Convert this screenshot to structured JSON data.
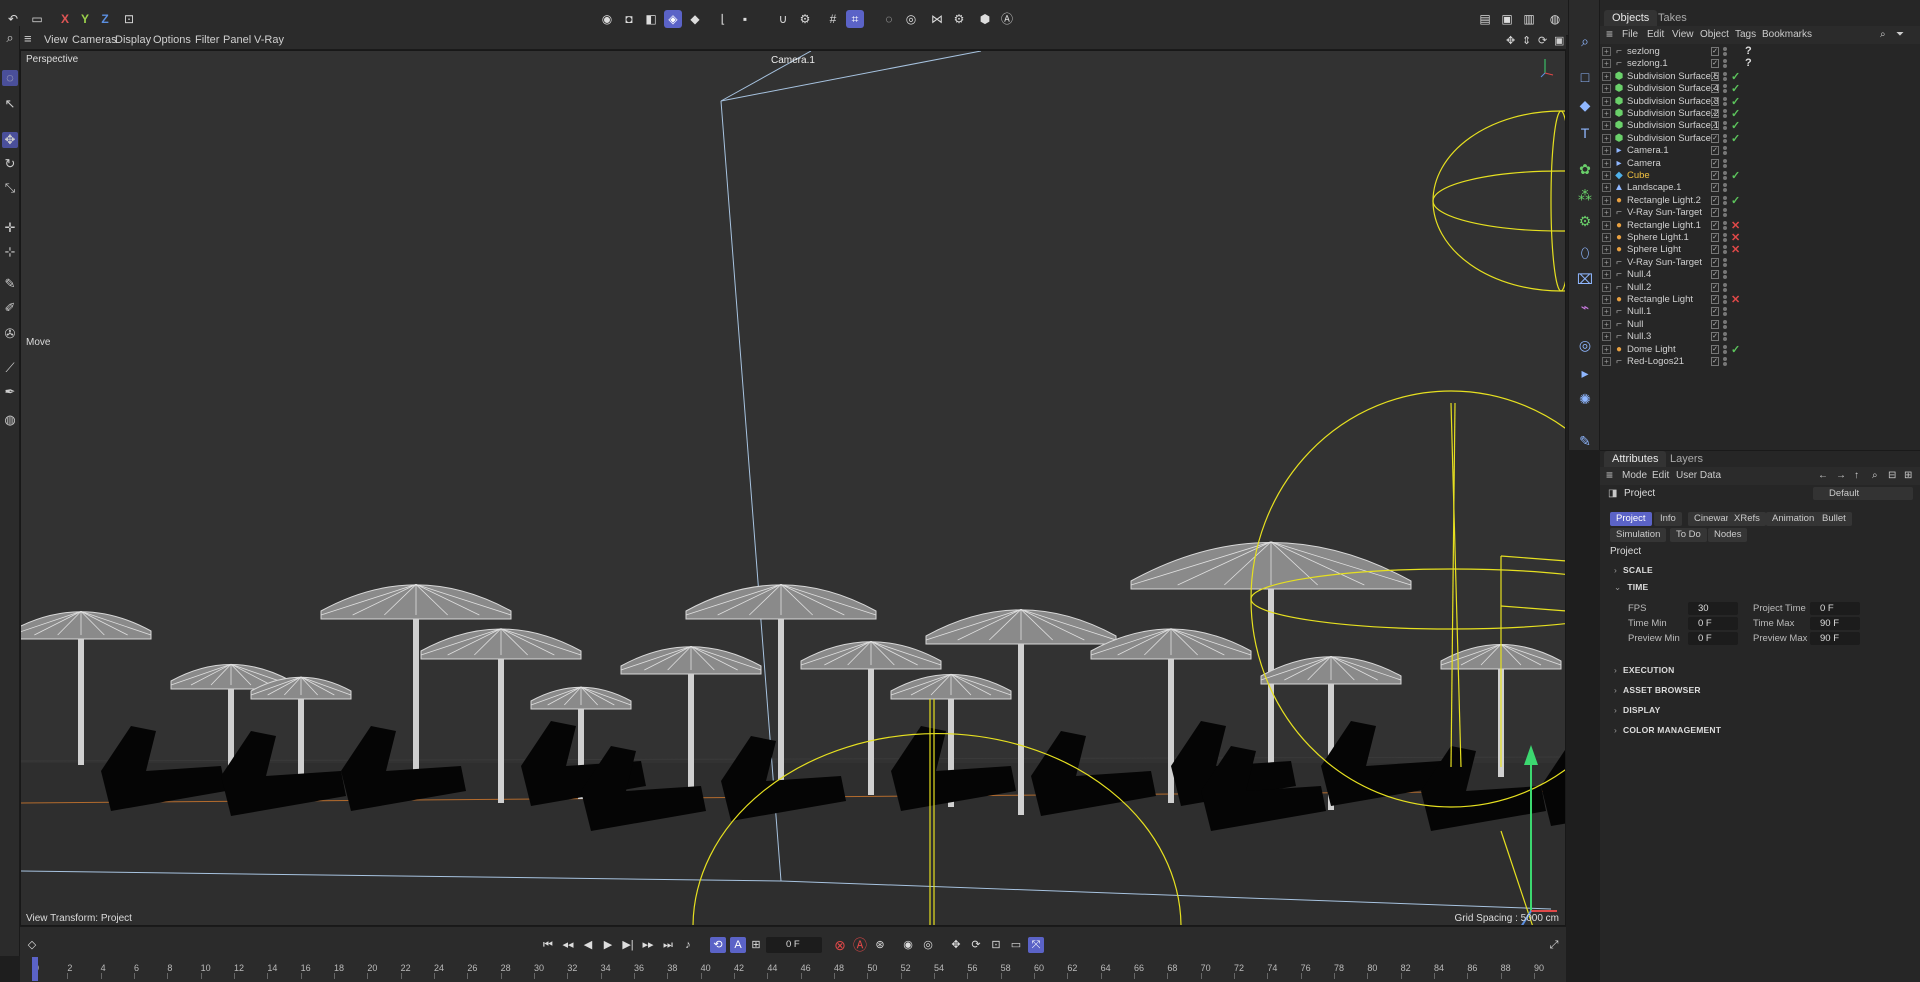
{
  "toolbar": {
    "axis_x": "X",
    "axis_y": "Y",
    "axis_z": "Z"
  },
  "viewport_menu": [
    "View",
    "Cameras",
    "Display",
    "Options",
    "Filter",
    "Panel",
    "V-Ray"
  ],
  "viewport": {
    "view_name": "Perspective",
    "camera_label": "Camera.1",
    "tool_label": "Move",
    "view_transform": "View Transform: Project",
    "grid_spacing": "Grid Spacing : 5000 cm"
  },
  "objects_panel": {
    "tabs": [
      "Objects",
      "Takes"
    ],
    "menu": [
      "File",
      "Edit",
      "View",
      "Object",
      "Tags",
      "Bookmarks"
    ],
    "items": [
      {
        "name": "sezlong",
        "tag": "?"
      },
      {
        "name": "sezlong.1",
        "tag": "?"
      },
      {
        "name": "Subdivision Surface.5",
        "tag": "✓"
      },
      {
        "name": "Subdivision Surface.4",
        "tag": "✓"
      },
      {
        "name": "Subdivision Surface.3",
        "tag": "✓"
      },
      {
        "name": "Subdivision Surface.2",
        "tag": "✓"
      },
      {
        "name": "Subdivision Surface.1",
        "tag": "✓"
      },
      {
        "name": "Subdivision Surface",
        "tag": "✓"
      },
      {
        "name": "Camera.1",
        "tag": ""
      },
      {
        "name": "Camera",
        "tag": ""
      },
      {
        "name": "Cube",
        "tag": "✓"
      },
      {
        "name": "Landscape.1",
        "tag": ""
      },
      {
        "name": "Rectangle Light.2",
        "tag": "✓"
      },
      {
        "name": "V-Ray Sun-Target",
        "tag": ""
      },
      {
        "name": "Rectangle Light.1",
        "tag": "✕"
      },
      {
        "name": "Sphere Light.1",
        "tag": "✕"
      },
      {
        "name": "Sphere Light",
        "tag": "✕"
      },
      {
        "name": "V-Ray Sun-Target",
        "tag": ""
      },
      {
        "name": "Null.4",
        "tag": ""
      },
      {
        "name": "Null.2",
        "tag": ""
      },
      {
        "name": "Rectangle Light",
        "tag": "✕"
      },
      {
        "name": "Null.1",
        "tag": ""
      },
      {
        "name": "Null",
        "tag": ""
      },
      {
        "name": "Null.3",
        "tag": ""
      },
      {
        "name": "Dome Light",
        "tag": "✓"
      },
      {
        "name": "Red-Logos21",
        "tag": ""
      }
    ]
  },
  "attributes_panel": {
    "tabs": [
      "Attributes",
      "Layers"
    ],
    "menu": [
      "Mode",
      "Edit",
      "User Data"
    ],
    "object_label": "Project",
    "preset": "Default",
    "buttons_row1": [
      "Project",
      "Info",
      "Cineware",
      "XRefs",
      "Animation",
      "Bullet"
    ],
    "buttons_row2": [
      "Simulation",
      "To Do",
      "Nodes"
    ],
    "section_title": "Project",
    "sections": [
      "SCALE",
      "TIME",
      "EXECUTION",
      "ASSET BROWSER",
      "DISPLAY",
      "COLOR MANAGEMENT"
    ],
    "time_fields": {
      "fps_label": "FPS",
      "fps": "30",
      "project_time_label": "Project Time",
      "project_time": "0 F",
      "time_min_label": "Time Min",
      "time_min": "0 F",
      "time_max_label": "Time Max",
      "time_max": "90 F",
      "preview_min_label": "Preview Min",
      "preview_min": "0 F",
      "preview_max_label": "Preview Max",
      "preview_max": "90 F"
    }
  },
  "timeline": {
    "current_frame": "0 F",
    "ticks": [
      "0",
      "2",
      "4",
      "6",
      "8",
      "10",
      "12",
      "14",
      "16",
      "18",
      "20",
      "22",
      "24",
      "26",
      "28",
      "30",
      "32",
      "34",
      "36",
      "38",
      "40",
      "42",
      "44",
      "46",
      "48",
      "50",
      "52",
      "54",
      "56",
      "58",
      "60",
      "62",
      "64",
      "66",
      "68",
      "70",
      "72",
      "74",
      "76",
      "78",
      "80",
      "82",
      "84",
      "86",
      "88",
      "90"
    ]
  },
  "colors": {
    "accent": "#5b63c7",
    "selection_yellow": "#e6e020",
    "check_green": "#5cc45c",
    "cross_red": "#e04848"
  }
}
